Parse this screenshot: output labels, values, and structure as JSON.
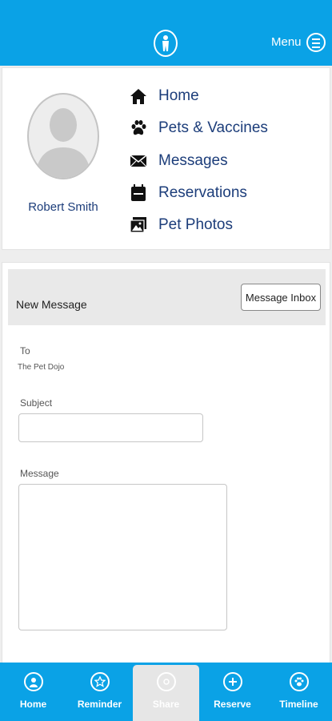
{
  "header": {
    "menu_label": "Menu"
  },
  "profile": {
    "name": "Robert Smith"
  },
  "nav": [
    {
      "label": "Home",
      "icon": "home-icon"
    },
    {
      "label": "Pets & Vaccines",
      "icon": "paw-icon"
    },
    {
      "label": "Messages",
      "icon": "envelope-icon"
    },
    {
      "label": "Reservations",
      "icon": "calendar-icon"
    },
    {
      "label": "Pet Photos",
      "icon": "photos-icon"
    }
  ],
  "message_form": {
    "title": "New Message",
    "inbox_button": "Message Inbox",
    "to_label": "To",
    "to_value": "The Pet Dojo",
    "subject_label": "Subject",
    "subject_value": "",
    "message_label": "Message",
    "message_value": ""
  },
  "tabs": [
    {
      "label": "Home",
      "icon": "user-icon"
    },
    {
      "label": "Reminder",
      "icon": "star-icon"
    },
    {
      "label": "Share",
      "icon": "share-icon",
      "active": true
    },
    {
      "label": "Reserve",
      "icon": "plus-icon"
    },
    {
      "label": "Timeline",
      "icon": "paw-icon"
    }
  ],
  "colors": {
    "brand_blue": "#0aa2e6",
    "nav_text": "#1c3d7a"
  }
}
